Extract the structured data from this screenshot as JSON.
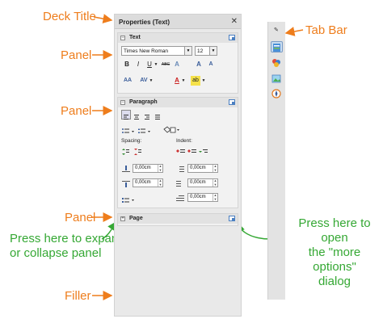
{
  "annotations": {
    "deck_title": "Deck Title",
    "panel_1": "Panel",
    "panel_2": "Panel",
    "panel_3": "Panel",
    "filler": "Filler",
    "tab_bar": "Tab Bar",
    "expand_hint_line1": "Press here to expand",
    "expand_hint_line2": "or collapse panel",
    "more_options_line1": "Press here to open",
    "more_options_line2": "the \"more options\"",
    "more_options_line3": "dialog"
  },
  "deck": {
    "title": "Properties (Text)",
    "close_glyph": "✕"
  },
  "text_panel": {
    "title": "Text",
    "expander": "−",
    "font_name": "Times New Roman",
    "font_size": "12",
    "bold": "B",
    "italic": "I",
    "underline": "U",
    "strikethrough": "ABC",
    "shadow": "A",
    "grow": "A",
    "shrink": "A",
    "case": "AA",
    "spacing": "AV",
    "font_color": "A",
    "highlight": "ab"
  },
  "paragraph_panel": {
    "title": "Paragraph",
    "expander": "−",
    "spacing_label": "Spacing:",
    "indent_label": "Indent:",
    "above_value": "0,00cm",
    "below_value": "0,00cm",
    "before_value": "0,00cm",
    "after_value": "0,00cm",
    "first_line_value": "0,00cm",
    "line_spacing_value": "0,00cm"
  },
  "page_panel": {
    "title": "Page",
    "expander": "+"
  },
  "colors": {
    "annotation_orange": "#ee7d1c",
    "annotation_green": "#35a834",
    "more_options_blue": "#4a7fc1"
  },
  "tab_icons": [
    "expand-tabs-icon",
    "properties-icon",
    "styles-icon",
    "gallery-icon",
    "navigator-icon"
  ]
}
